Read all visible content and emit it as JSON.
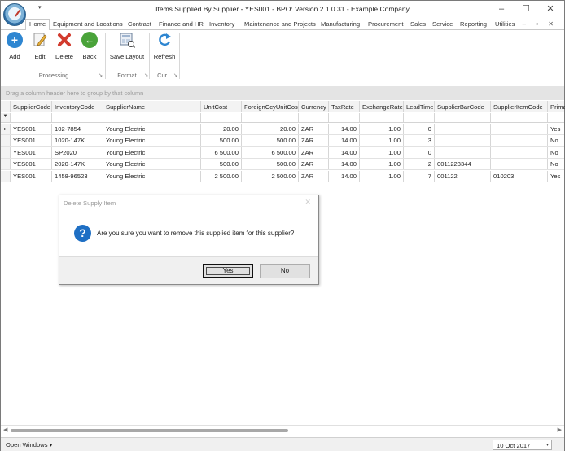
{
  "window": {
    "title": "Items Supplied By Supplier - YES001 - BPO: Version 2.1.0.31 - Example Company",
    "qat_arrow": "▾",
    "minimize": "–",
    "maximize": "☐",
    "close": "✕"
  },
  "menu": {
    "tabs": [
      "Home",
      "Equipment and Locations",
      "Contract",
      "Finance and HR",
      "Inventory",
      "Maintenance and Projects",
      "Manufacturing",
      "Procurement",
      "Sales",
      "Service",
      "Reporting",
      "Utilities"
    ],
    "right_icons": "– ▫ ✕"
  },
  "ribbon": {
    "buttons": {
      "add": "Add",
      "edit": "Edit",
      "delete": "Delete",
      "back": "Back",
      "save_layout": "Save Layout",
      "refresh": "Refresh"
    },
    "groups": {
      "processing": "Processing",
      "format": "Format",
      "current": "Cur..."
    }
  },
  "groupby_hint": "Drag a column header here to group by that column",
  "grid": {
    "columns": [
      "SupplierCode",
      "InventoryCode",
      "SupplierName",
      "UnitCost",
      "ForeignCcyUnitCost",
      "Currency",
      "TaxRate",
      "ExchangeRate",
      "LeadTime",
      "SupplierBarCode",
      "SupplierItemCode",
      "Prima"
    ],
    "filter_icon": "▼",
    "row_indicator": "▸",
    "rows": [
      [
        "YES001",
        "102-7854",
        "Young Electric",
        "20.00",
        "20.00",
        "ZAR",
        "14.00",
        "1.00",
        "0",
        "",
        "",
        "Yes"
      ],
      [
        "YES001",
        "1020-147K",
        "Young Electric",
        "500.00",
        "500.00",
        "ZAR",
        "14.00",
        "1.00",
        "3",
        "",
        "",
        "No"
      ],
      [
        "YES001",
        "SP2020",
        "Young Electric",
        "6 500.00",
        "6 500.00",
        "ZAR",
        "14.00",
        "1.00",
        "0",
        "",
        "",
        "No"
      ],
      [
        "YES001",
        "2020-147K",
        "Young Electric",
        "500.00",
        "500.00",
        "ZAR",
        "14.00",
        "1.00",
        "2",
        "0011223344",
        "",
        "No"
      ],
      [
        "YES001",
        "1458-96523",
        "Young Electric",
        "2 500.00",
        "2 500.00",
        "ZAR",
        "14.00",
        "1.00",
        "7",
        "001122",
        "010203",
        "Yes"
      ]
    ]
  },
  "dialog": {
    "title": "Delete Supply Item",
    "close": "✕",
    "icon": "?",
    "message": "Are you sure you want to remove this supplied item for this supplier?",
    "yes": "Yes",
    "no": "No"
  },
  "status": {
    "open_windows": "Open Windows ▾",
    "date": "10 Oct 2017",
    "date_arrow": "▾"
  },
  "colors": {
    "add": "#2e86d1",
    "delete": "#d23b2e",
    "back": "#4aa33a",
    "question": "#1e6fc4"
  }
}
